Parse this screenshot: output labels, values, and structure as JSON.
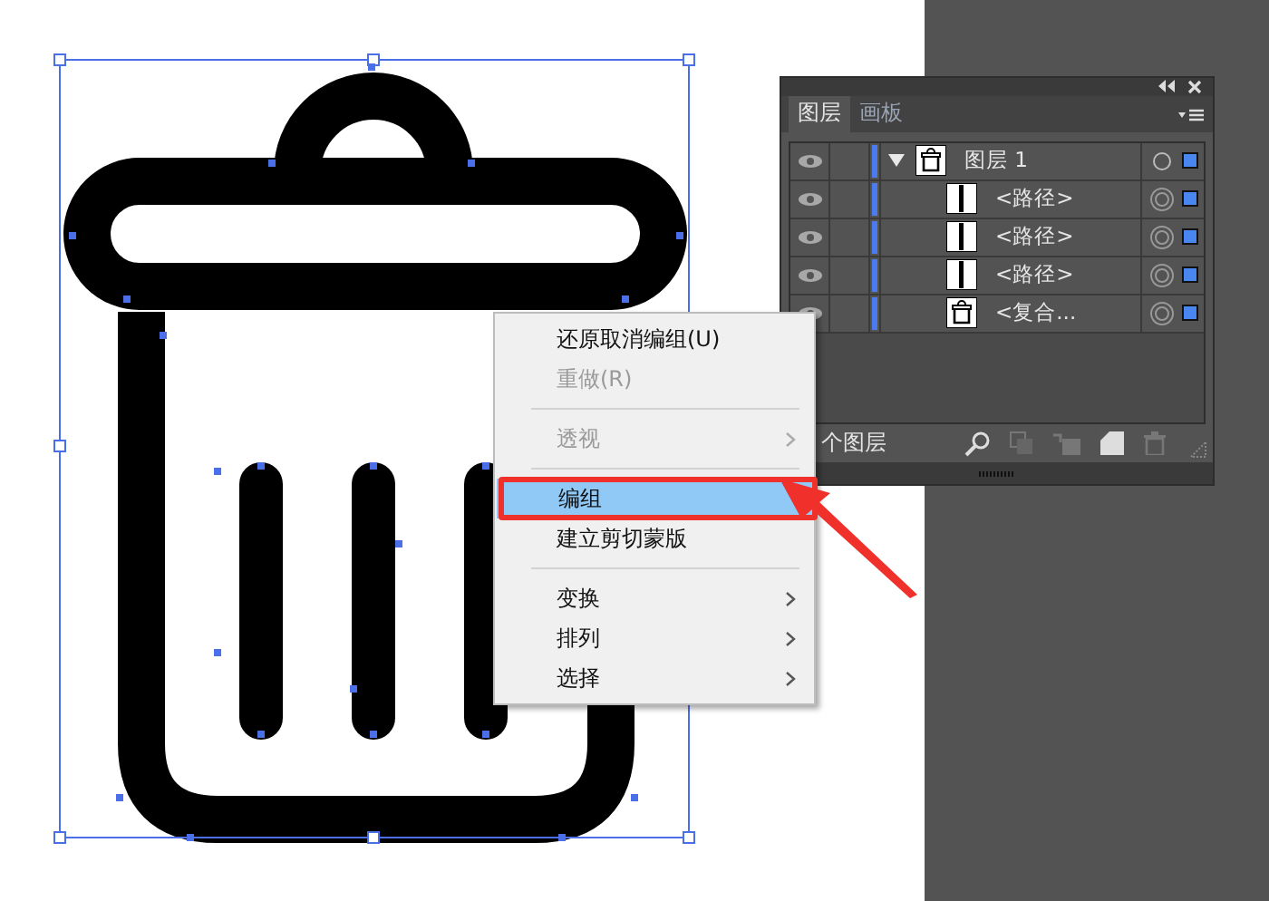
{
  "layers_panel": {
    "tabs": [
      {
        "label": "图层",
        "selected": true
      },
      {
        "label": "画板",
        "selected": false
      }
    ],
    "layers": [
      {
        "name": "图层 1",
        "expanded": true,
        "kind": "can",
        "children": [
          {
            "name": "<路径>",
            "kind": "bar"
          },
          {
            "name": "<路径>",
            "kind": "bar"
          },
          {
            "name": "<路径>",
            "kind": "bar"
          },
          {
            "name": "<复合...",
            "kind": "can"
          }
        ]
      }
    ],
    "status": "个图层"
  },
  "context_menu": {
    "groups": [
      [
        {
          "label": "还原取消编组(U)",
          "disabled": false,
          "submenu": false,
          "selected": false
        },
        {
          "label": "重做(R)",
          "disabled": true,
          "submenu": false,
          "selected": false
        }
      ],
      [
        {
          "label": "透视",
          "disabled": true,
          "submenu": true,
          "selected": false
        }
      ],
      [
        {
          "label": "编组",
          "disabled": false,
          "submenu": false,
          "selected": true
        },
        {
          "label": "建立剪切蒙版",
          "disabled": false,
          "submenu": false,
          "selected": false
        }
      ],
      [
        {
          "label": "变换",
          "disabled": false,
          "submenu": true,
          "selected": false
        },
        {
          "label": "排列",
          "disabled": false,
          "submenu": true,
          "selected": false
        },
        {
          "label": "选择",
          "disabled": false,
          "submenu": true,
          "selected": false
        }
      ]
    ]
  }
}
